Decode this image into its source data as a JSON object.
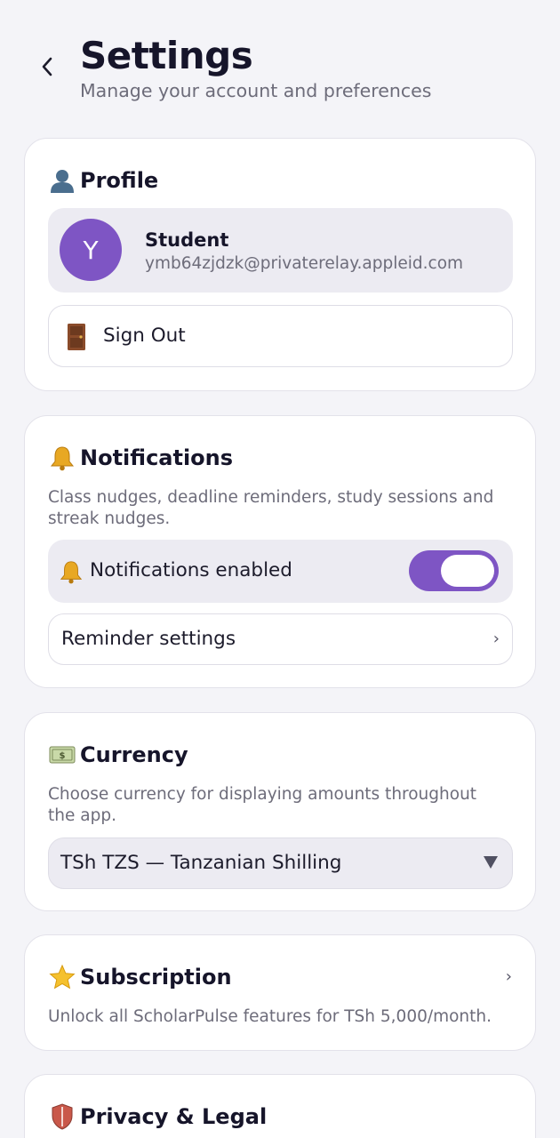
{
  "header": {
    "title": "Settings",
    "subtitle": "Manage your account and preferences"
  },
  "profile": {
    "section_title": "Profile",
    "section_icon": "bust-in-silhouette-icon",
    "avatar_initial": "Y",
    "name": "Student",
    "email": "ymb64zjdzk@privaterelay.appleid.com",
    "sign_out_label": "Sign Out",
    "sign_out_icon": "door-icon"
  },
  "notifications": {
    "section_title": "Notifications",
    "section_icon": "bell-icon",
    "description": "Class nudges, deadline reminders, study sessions and streak nudges.",
    "toggle_label": "Notifications enabled",
    "enabled": true,
    "reminder_label": "Reminder settings"
  },
  "currency": {
    "section_title": "Currency",
    "section_icon": "money-icon",
    "description": "Choose currency for displaying amounts throughout the app.",
    "selected": "TSh TZS — Tanzanian Shilling"
  },
  "subscription": {
    "section_title": "Subscription",
    "section_icon": "star-icon",
    "description": "Unlock all ScholarPulse features for TSh 5,000/month."
  },
  "privacy": {
    "section_title": "Privacy & Legal",
    "section_icon": "shield-icon"
  },
  "colors": {
    "accent": "#7e55c4",
    "background": "#f4f4f8",
    "card": "#ffffff",
    "row_fill": "#ecebf2"
  }
}
